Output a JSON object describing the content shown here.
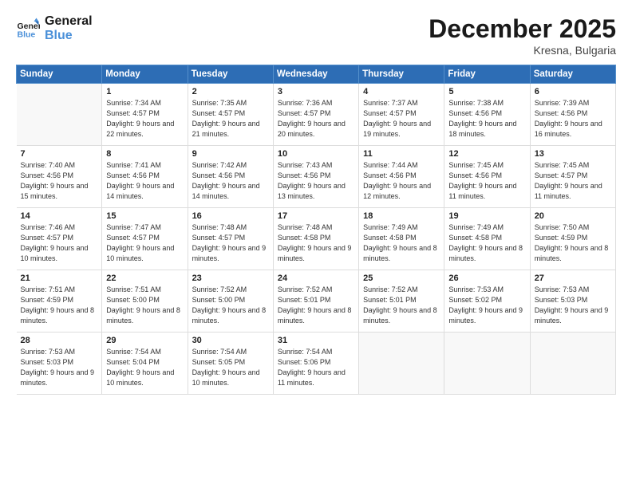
{
  "logo": {
    "line1": "General",
    "line2": "Blue"
  },
  "title": "December 2025",
  "location": "Kresna, Bulgaria",
  "weekdays": [
    "Sunday",
    "Monday",
    "Tuesday",
    "Wednesday",
    "Thursday",
    "Friday",
    "Saturday"
  ],
  "weeks": [
    [
      {
        "day": "",
        "sunrise": "",
        "sunset": "",
        "daylight": "",
        "empty": true
      },
      {
        "day": "1",
        "sunrise": "Sunrise: 7:34 AM",
        "sunset": "Sunset: 4:57 PM",
        "daylight": "Daylight: 9 hours and 22 minutes."
      },
      {
        "day": "2",
        "sunrise": "Sunrise: 7:35 AM",
        "sunset": "Sunset: 4:57 PM",
        "daylight": "Daylight: 9 hours and 21 minutes."
      },
      {
        "day": "3",
        "sunrise": "Sunrise: 7:36 AM",
        "sunset": "Sunset: 4:57 PM",
        "daylight": "Daylight: 9 hours and 20 minutes."
      },
      {
        "day": "4",
        "sunrise": "Sunrise: 7:37 AM",
        "sunset": "Sunset: 4:57 PM",
        "daylight": "Daylight: 9 hours and 19 minutes."
      },
      {
        "day": "5",
        "sunrise": "Sunrise: 7:38 AM",
        "sunset": "Sunset: 4:56 PM",
        "daylight": "Daylight: 9 hours and 18 minutes."
      },
      {
        "day": "6",
        "sunrise": "Sunrise: 7:39 AM",
        "sunset": "Sunset: 4:56 PM",
        "daylight": "Daylight: 9 hours and 16 minutes."
      }
    ],
    [
      {
        "day": "7",
        "sunrise": "Sunrise: 7:40 AM",
        "sunset": "Sunset: 4:56 PM",
        "daylight": "Daylight: 9 hours and 15 minutes."
      },
      {
        "day": "8",
        "sunrise": "Sunrise: 7:41 AM",
        "sunset": "Sunset: 4:56 PM",
        "daylight": "Daylight: 9 hours and 14 minutes."
      },
      {
        "day": "9",
        "sunrise": "Sunrise: 7:42 AM",
        "sunset": "Sunset: 4:56 PM",
        "daylight": "Daylight: 9 hours and 14 minutes."
      },
      {
        "day": "10",
        "sunrise": "Sunrise: 7:43 AM",
        "sunset": "Sunset: 4:56 PM",
        "daylight": "Daylight: 9 hours and 13 minutes."
      },
      {
        "day": "11",
        "sunrise": "Sunrise: 7:44 AM",
        "sunset": "Sunset: 4:56 PM",
        "daylight": "Daylight: 9 hours and 12 minutes."
      },
      {
        "day": "12",
        "sunrise": "Sunrise: 7:45 AM",
        "sunset": "Sunset: 4:56 PM",
        "daylight": "Daylight: 9 hours and 11 minutes."
      },
      {
        "day": "13",
        "sunrise": "Sunrise: 7:45 AM",
        "sunset": "Sunset: 4:57 PM",
        "daylight": "Daylight: 9 hours and 11 minutes."
      }
    ],
    [
      {
        "day": "14",
        "sunrise": "Sunrise: 7:46 AM",
        "sunset": "Sunset: 4:57 PM",
        "daylight": "Daylight: 9 hours and 10 minutes."
      },
      {
        "day": "15",
        "sunrise": "Sunrise: 7:47 AM",
        "sunset": "Sunset: 4:57 PM",
        "daylight": "Daylight: 9 hours and 10 minutes."
      },
      {
        "day": "16",
        "sunrise": "Sunrise: 7:48 AM",
        "sunset": "Sunset: 4:57 PM",
        "daylight": "Daylight: 9 hours and 9 minutes."
      },
      {
        "day": "17",
        "sunrise": "Sunrise: 7:48 AM",
        "sunset": "Sunset: 4:58 PM",
        "daylight": "Daylight: 9 hours and 9 minutes."
      },
      {
        "day": "18",
        "sunrise": "Sunrise: 7:49 AM",
        "sunset": "Sunset: 4:58 PM",
        "daylight": "Daylight: 9 hours and 8 minutes."
      },
      {
        "day": "19",
        "sunrise": "Sunrise: 7:49 AM",
        "sunset": "Sunset: 4:58 PM",
        "daylight": "Daylight: 9 hours and 8 minutes."
      },
      {
        "day": "20",
        "sunrise": "Sunrise: 7:50 AM",
        "sunset": "Sunset: 4:59 PM",
        "daylight": "Daylight: 9 hours and 8 minutes."
      }
    ],
    [
      {
        "day": "21",
        "sunrise": "Sunrise: 7:51 AM",
        "sunset": "Sunset: 4:59 PM",
        "daylight": "Daylight: 9 hours and 8 minutes."
      },
      {
        "day": "22",
        "sunrise": "Sunrise: 7:51 AM",
        "sunset": "Sunset: 5:00 PM",
        "daylight": "Daylight: 9 hours and 8 minutes."
      },
      {
        "day": "23",
        "sunrise": "Sunrise: 7:52 AM",
        "sunset": "Sunset: 5:00 PM",
        "daylight": "Daylight: 9 hours and 8 minutes."
      },
      {
        "day": "24",
        "sunrise": "Sunrise: 7:52 AM",
        "sunset": "Sunset: 5:01 PM",
        "daylight": "Daylight: 9 hours and 8 minutes."
      },
      {
        "day": "25",
        "sunrise": "Sunrise: 7:52 AM",
        "sunset": "Sunset: 5:01 PM",
        "daylight": "Daylight: 9 hours and 8 minutes."
      },
      {
        "day": "26",
        "sunrise": "Sunrise: 7:53 AM",
        "sunset": "Sunset: 5:02 PM",
        "daylight": "Daylight: 9 hours and 9 minutes."
      },
      {
        "day": "27",
        "sunrise": "Sunrise: 7:53 AM",
        "sunset": "Sunset: 5:03 PM",
        "daylight": "Daylight: 9 hours and 9 minutes."
      }
    ],
    [
      {
        "day": "28",
        "sunrise": "Sunrise: 7:53 AM",
        "sunset": "Sunset: 5:03 PM",
        "daylight": "Daylight: 9 hours and 9 minutes."
      },
      {
        "day": "29",
        "sunrise": "Sunrise: 7:54 AM",
        "sunset": "Sunset: 5:04 PM",
        "daylight": "Daylight: 9 hours and 10 minutes."
      },
      {
        "day": "30",
        "sunrise": "Sunrise: 7:54 AM",
        "sunset": "Sunset: 5:05 PM",
        "daylight": "Daylight: 9 hours and 10 minutes."
      },
      {
        "day": "31",
        "sunrise": "Sunrise: 7:54 AM",
        "sunset": "Sunset: 5:06 PM",
        "daylight": "Daylight: 9 hours and 11 minutes."
      },
      {
        "day": "",
        "sunrise": "",
        "sunset": "",
        "daylight": "",
        "empty": true
      },
      {
        "day": "",
        "sunrise": "",
        "sunset": "",
        "daylight": "",
        "empty": true
      },
      {
        "day": "",
        "sunrise": "",
        "sunset": "",
        "daylight": "",
        "empty": true
      }
    ]
  ]
}
